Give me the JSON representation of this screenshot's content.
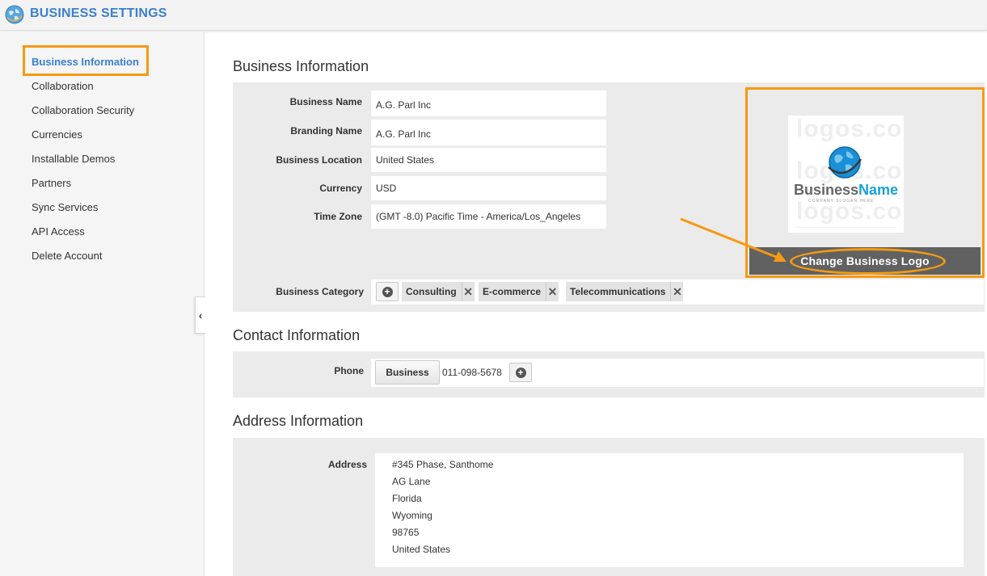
{
  "header": {
    "title": "BUSINESS SETTINGS",
    "icon": "globe-icon"
  },
  "sidebar": {
    "items": [
      {
        "label": "Business Information",
        "active": true
      },
      {
        "label": "Collaboration",
        "active": false
      },
      {
        "label": "Collaboration Security",
        "active": false
      },
      {
        "label": "Currencies",
        "active": false
      },
      {
        "label": "Installable Demos",
        "active": false
      },
      {
        "label": "Partners",
        "active": false
      },
      {
        "label": "Sync Services",
        "active": false
      },
      {
        "label": "API Access",
        "active": false
      },
      {
        "label": "Delete Account",
        "active": false
      }
    ],
    "collapse_glyph": "‹"
  },
  "business_info": {
    "title": "Business Information",
    "fields": [
      {
        "label": "Business Name",
        "value": "A.G. Parl Inc"
      },
      {
        "label": "Branding Name",
        "value": "A.G. Parl Inc"
      },
      {
        "label": "Business Location",
        "value": "United States"
      },
      {
        "label": "Currency",
        "value": "USD"
      },
      {
        "label": "Time Zone",
        "value": "(GMT -8.0) Pacific Time - America/Los_Angeles"
      }
    ],
    "category_label": "Business Category",
    "categories": [
      "Consulting",
      "E-commerce",
      "Telecommunications"
    ],
    "remove_glyph": "✕",
    "add_glyph": "+",
    "logo": {
      "watermark": "logos.co",
      "name_part1": "Business",
      "name_part2": "Name",
      "slogan": "COMPANY SLOGAN HERE",
      "change_label": "Change Business Logo"
    }
  },
  "contact_info": {
    "title": "Contact Information",
    "phone_label": "Phone",
    "phone_type": "Business",
    "phone_number": "011-098-5678"
  },
  "address_info": {
    "title": "Address Information",
    "address_label": "Address",
    "lines": [
      "#345 Phase, Santhome",
      "AG Lane",
      "Florida",
      "Wyoming",
      "98765",
      "United States"
    ]
  },
  "colors": {
    "accent": "#3a7fd0",
    "highlight": "#f59a12",
    "logo_button": "#616161"
  }
}
